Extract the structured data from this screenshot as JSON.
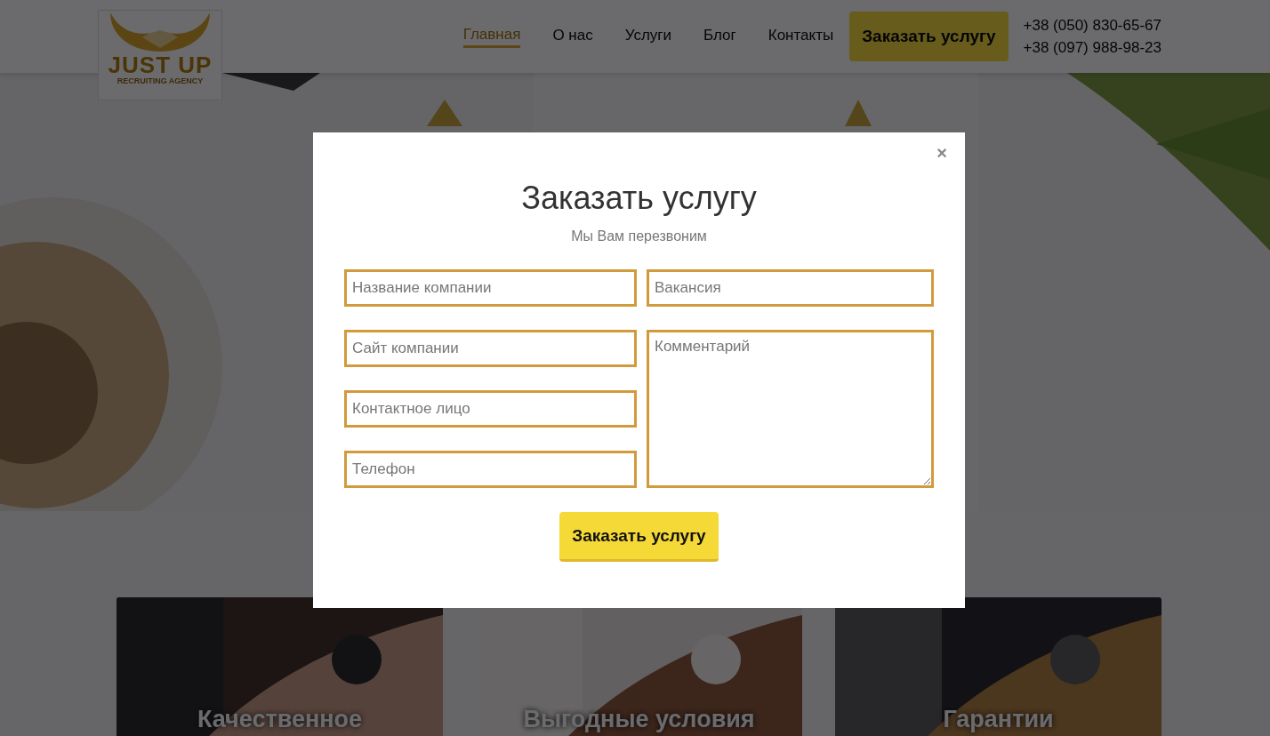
{
  "header": {
    "logo": {
      "title": "JUST UP",
      "subtitle": "RECRUITING AGENCY"
    },
    "nav": [
      {
        "label": "Главная",
        "selected": true
      },
      {
        "label": "О нас",
        "selected": false
      },
      {
        "label": "Услуги",
        "selected": false
      },
      {
        "label": "Блог",
        "selected": false
      },
      {
        "label": "Контакты",
        "selected": false
      }
    ],
    "order_button": "Заказать услугу",
    "phones": [
      "+38 (050) 830-65-67",
      "+38 (097) 988-98-23"
    ]
  },
  "cards": [
    {
      "title": "Качественное"
    },
    {
      "title": "Выгодные условия"
    },
    {
      "title": "Гарантии"
    }
  ],
  "modal": {
    "close": "×",
    "title": "Заказать услугу",
    "subtitle": "Мы Вам перезвоним",
    "fields": [
      {
        "kind": "input",
        "placeholder": "Название компании"
      },
      {
        "kind": "input",
        "placeholder": "Вакансия"
      },
      {
        "kind": "input",
        "placeholder": "Сайт компании"
      },
      {
        "kind": "textarea",
        "placeholder": "Комментарий"
      },
      {
        "kind": "input",
        "placeholder": "Контактное лицо"
      },
      {
        "kind": "input",
        "placeholder": "Телефон"
      }
    ],
    "submit": "Заказать услугу"
  }
}
